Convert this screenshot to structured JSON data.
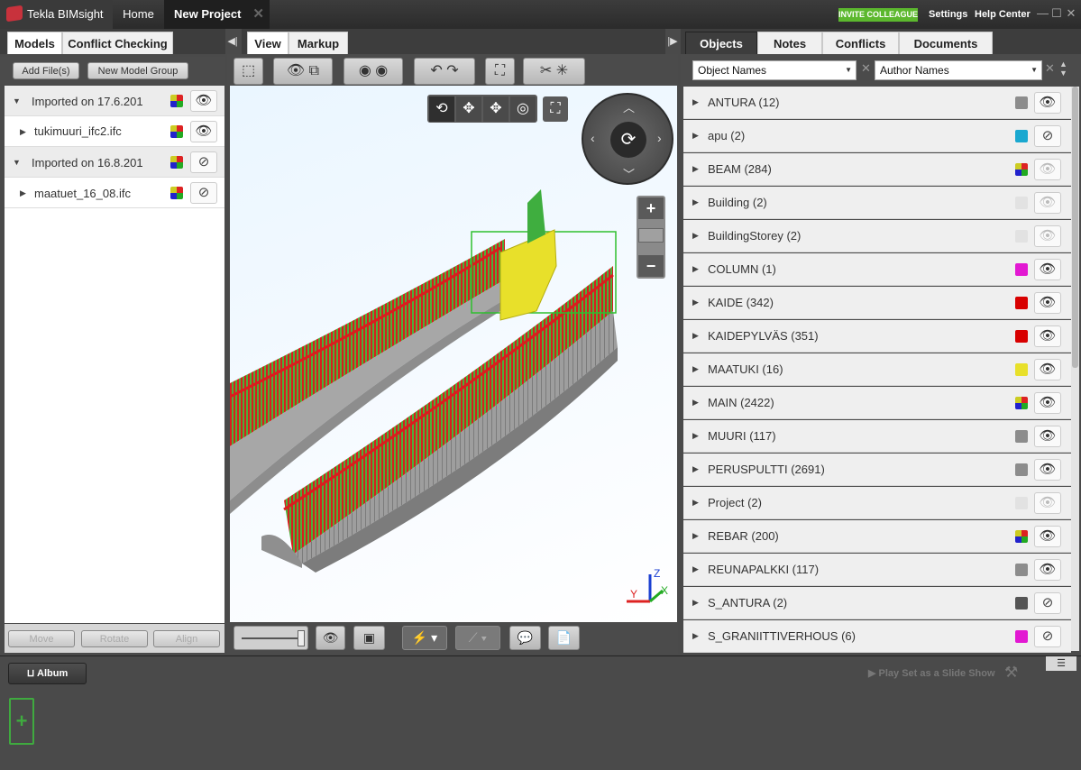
{
  "titlebar": {
    "app_name": "Tekla BIMsight",
    "home_tab": "Home",
    "project_tab": "New Project",
    "invite": "INVITE COLLEAGUE",
    "settings": "Settings",
    "help": "Help Center"
  },
  "left_panel": {
    "tabs": [
      "Models",
      "Conflict Checking"
    ],
    "add_files": "Add File(s)",
    "new_group": "New Model Group",
    "models": [
      {
        "label": "Imported on 17.6.201",
        "group": true,
        "visible": true
      },
      {
        "label": "tukimuuri_ifc2.ifc",
        "group": false,
        "visible": true
      },
      {
        "label": "Imported on 16.8.201",
        "group": true,
        "visible": false
      },
      {
        "label": "maatuet_16_08.ifc",
        "group": false,
        "visible": false
      }
    ],
    "bottom_buttons": [
      "Move",
      "Rotate",
      "Align"
    ]
  },
  "center_panel": {
    "tabs": [
      "View",
      "Markup"
    ]
  },
  "right_panel": {
    "tabs": [
      "Objects",
      "Notes",
      "Conflicts",
      "Documents"
    ],
    "filter1": "Object Names",
    "filter2": "Author Names",
    "objects": [
      {
        "label": "ANTURA (12)",
        "color": "#8c8c8c",
        "eye": "visible"
      },
      {
        "label": "apu (2)",
        "color": "#1aa8d0",
        "eye": "hidden"
      },
      {
        "label": "BEAM (284)",
        "color": "multi",
        "eye": "faded"
      },
      {
        "label": "Building (2)",
        "color": "#e2e2e2",
        "eye": "faded"
      },
      {
        "label": "BuildingStorey (2)",
        "color": "#e2e2e2",
        "eye": "faded"
      },
      {
        "label": "COLUMN (1)",
        "color": "#e218d2",
        "eye": "visible"
      },
      {
        "label": "KAIDE (342)",
        "color": "#d80000",
        "eye": "visible"
      },
      {
        "label": "KAIDEPYLVÄS (351)",
        "color": "#d80000",
        "eye": "visible"
      },
      {
        "label": "MAATUKI (16)",
        "color": "#e8e02a",
        "eye": "visible"
      },
      {
        "label": "MAIN (2422)",
        "color": "multi",
        "eye": "visible"
      },
      {
        "label": "MUURI (117)",
        "color": "#8c8c8c",
        "eye": "visible"
      },
      {
        "label": "PERUSPULTTI (2691)",
        "color": "#8c8c8c",
        "eye": "visible"
      },
      {
        "label": "Project (2)",
        "color": "#e2e2e2",
        "eye": "faded"
      },
      {
        "label": "REBAR (200)",
        "color": "multi",
        "eye": "visible"
      },
      {
        "label": "REUNAPALKKI (117)",
        "color": "#8c8c8c",
        "eye": "visible"
      },
      {
        "label": "S_ANTURA (2)",
        "color": "#555555",
        "eye": "hidden"
      },
      {
        "label": "S_GRANIITTIVERHOUS (6)",
        "color": "#e218d2",
        "eye": "hidden"
      }
    ]
  },
  "album": {
    "label": "Album",
    "slideshow": "Play Set as a Slide Show"
  },
  "axes": {
    "x": "X",
    "y": "Y",
    "z": "Z"
  }
}
